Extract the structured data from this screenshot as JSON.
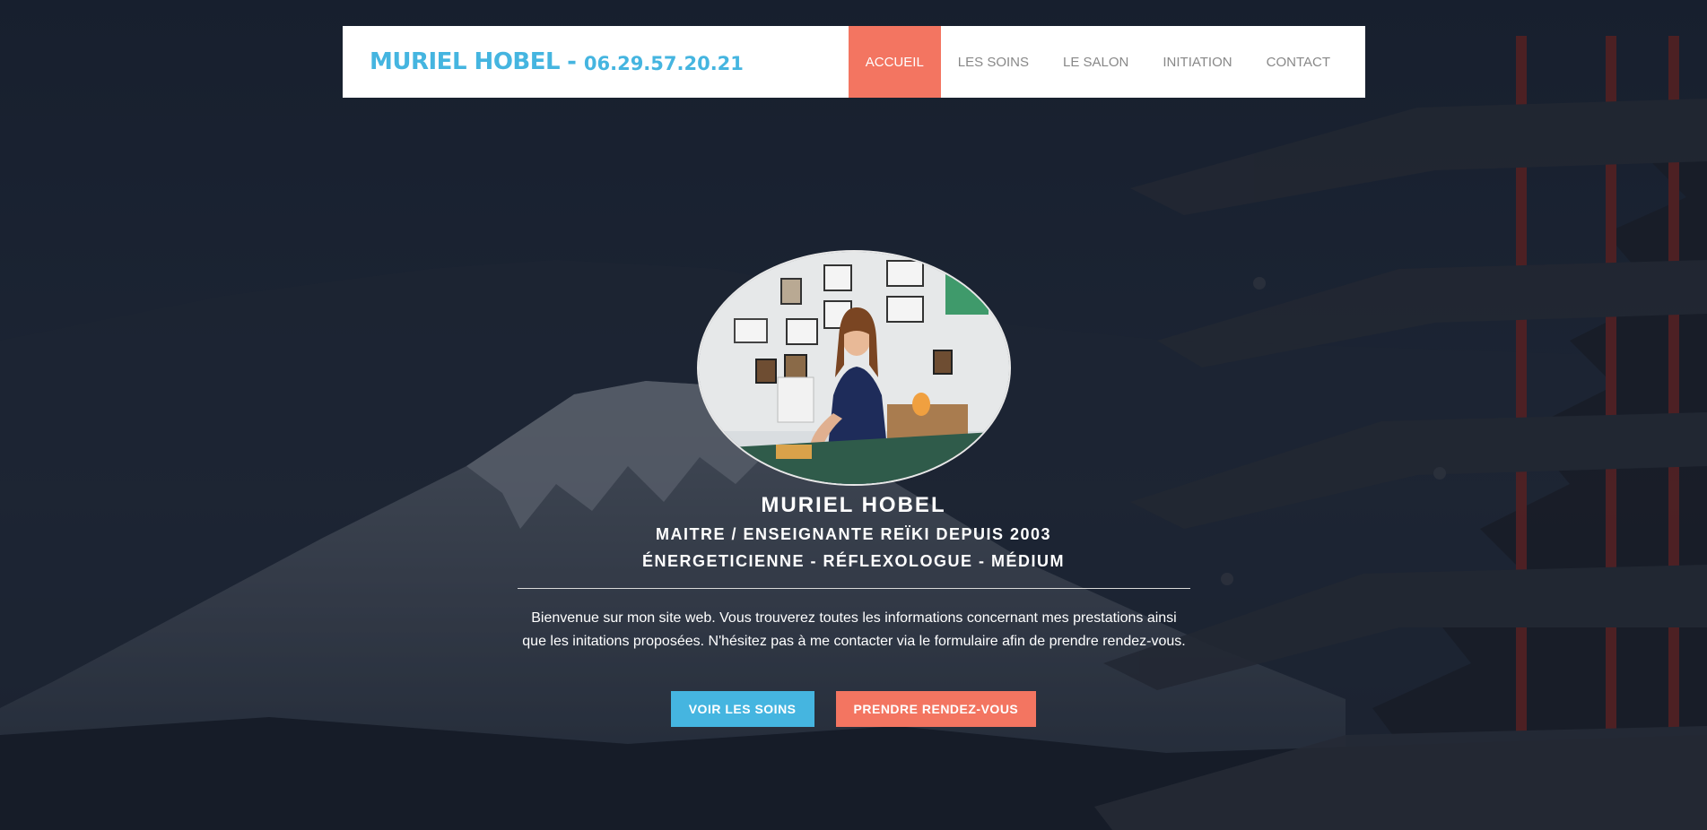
{
  "header": {
    "brand_name": "MURIEL HOBEL",
    "brand_separator": "-",
    "brand_phone": "06.29.57.20.21",
    "nav": [
      {
        "label": "ACCUEIL",
        "active": true
      },
      {
        "label": "LES SOINS",
        "active": false
      },
      {
        "label": "LE SALON",
        "active": false
      },
      {
        "label": "INITIATION",
        "active": false
      },
      {
        "label": "CONTACT",
        "active": false
      }
    ]
  },
  "hero": {
    "name": "MURIEL HOBEL",
    "subtitle_1": "MAITRE / ENSEIGNANTE REÏKI DEPUIS 2003",
    "subtitle_2": "ÉNERGETICIENNE - RÉFLEXOLOGUE - MÉDIUM",
    "intro": "Bienvenue sur mon site web. Vous trouverez toutes les informations concernant mes prestations ainsi que les initations proposées. N'hésitez pas à me contacter via le formulaire afin de prendre rendez-vous.",
    "button_primary": "VOIR LES SOINS",
    "button_secondary": "PRENDRE RENDEZ-VOUS"
  },
  "colors": {
    "accent_blue": "#45b5e0",
    "accent_coral": "#f37561",
    "overlay": "#1b2433"
  }
}
